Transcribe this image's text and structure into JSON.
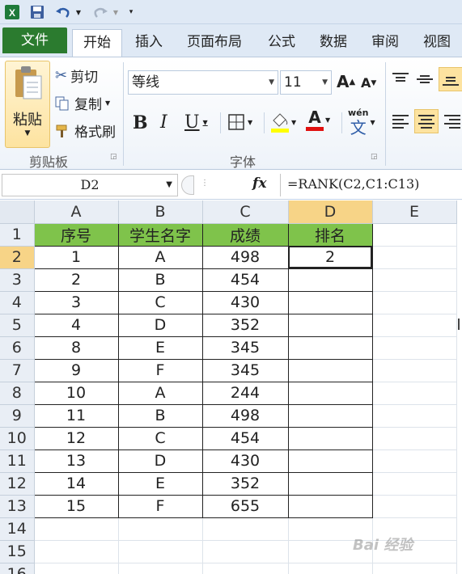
{
  "qat": {
    "excel_icon": "excel-logo-icon",
    "save_icon": "save-icon",
    "undo_icon": "undo-icon",
    "redo_icon": "redo-icon",
    "customize_icon": "customize-qat-icon"
  },
  "tabs": [
    {
      "label": "文件"
    },
    {
      "label": "开始"
    },
    {
      "label": "插入"
    },
    {
      "label": "页面布局"
    },
    {
      "label": "公式"
    },
    {
      "label": "数据"
    },
    {
      "label": "审阅"
    },
    {
      "label": "视图"
    }
  ],
  "ribbon": {
    "clipboard": {
      "paste": "粘贴",
      "cut": "剪切",
      "copy": "复制",
      "format_painter": "格式刷",
      "group_label": "剪贴板"
    },
    "font": {
      "font_name": "等线",
      "font_size": "11",
      "grow": "A",
      "shrink": "A",
      "bold": "B",
      "italic": "I",
      "underline": "U",
      "font_color_letter": "A",
      "phonetic": "wén",
      "phonetic_char": "文",
      "group_label": "字体"
    },
    "colors": {
      "accent": "#2b7b2f",
      "highlight": "#f7d487",
      "header_fill": "#7fc34b",
      "fill_yellow": "#ffff00",
      "font_red": "#e01010"
    }
  },
  "formula_bar": {
    "name_box": "D2",
    "fx": "fx",
    "formula": "=RANK(C2,C1:C13)"
  },
  "sheet": {
    "columns": [
      "A",
      "B",
      "C",
      "D",
      "E"
    ],
    "rows": [
      {
        "num": "1",
        "cells": [
          "序号",
          "学生名字",
          "成绩",
          "排名"
        ]
      },
      {
        "num": "2",
        "cells": [
          "1",
          "A",
          "498",
          "2"
        ]
      },
      {
        "num": "3",
        "cells": [
          "2",
          "B",
          "454",
          ""
        ]
      },
      {
        "num": "4",
        "cells": [
          "3",
          "C",
          "430",
          ""
        ]
      },
      {
        "num": "5",
        "cells": [
          "4",
          "D",
          "352",
          ""
        ]
      },
      {
        "num": "6",
        "cells": [
          "8",
          "E",
          "345",
          ""
        ]
      },
      {
        "num": "7",
        "cells": [
          "9",
          "F",
          "345",
          ""
        ]
      },
      {
        "num": "8",
        "cells": [
          "10",
          "A",
          "244",
          ""
        ]
      },
      {
        "num": "9",
        "cells": [
          "11",
          "B",
          "498",
          ""
        ]
      },
      {
        "num": "10",
        "cells": [
          "12",
          "C",
          "454",
          ""
        ]
      },
      {
        "num": "11",
        "cells": [
          "13",
          "D",
          "430",
          ""
        ]
      },
      {
        "num": "12",
        "cells": [
          "14",
          "E",
          "352",
          ""
        ]
      },
      {
        "num": "13",
        "cells": [
          "15",
          "F",
          "655",
          ""
        ]
      },
      {
        "num": "14",
        "cells": [
          "",
          "",
          "",
          ""
        ]
      },
      {
        "num": "15",
        "cells": [
          "",
          "",
          "",
          ""
        ]
      },
      {
        "num": "16",
        "cells": [
          "",
          "",
          "",
          ""
        ]
      }
    ]
  },
  "watermark": "Bai 经验"
}
